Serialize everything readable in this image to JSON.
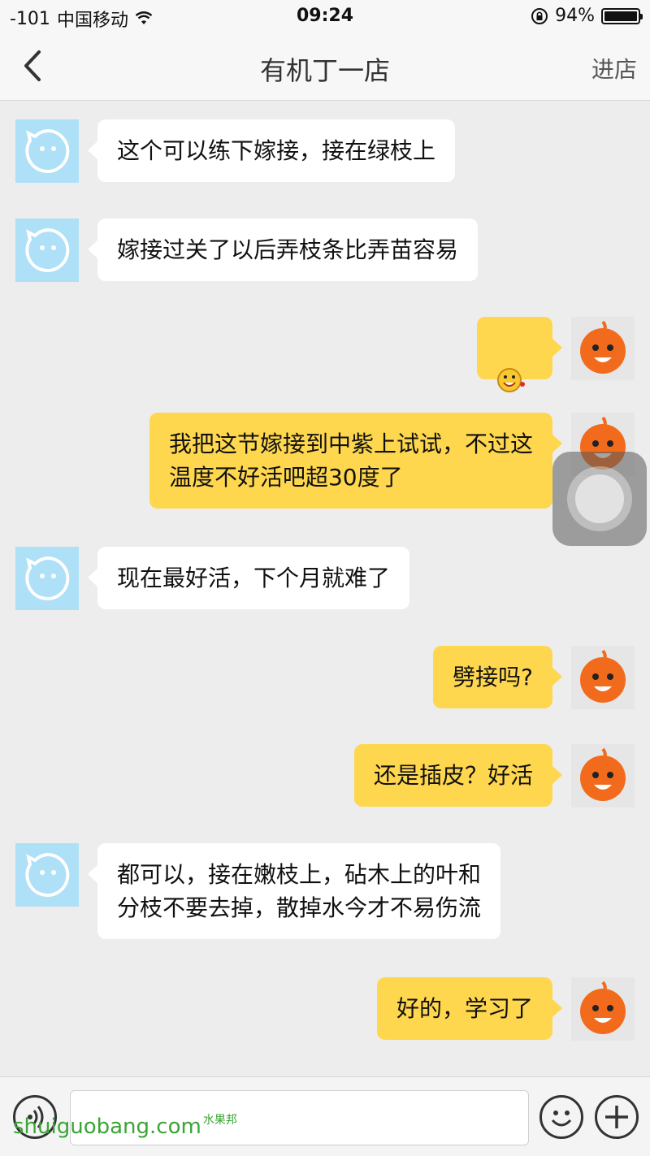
{
  "status_bar": {
    "signal": "-101",
    "carrier": "中国移动",
    "time": "09:24",
    "battery": "94%"
  },
  "header": {
    "title": "有机丁一店",
    "right_action": "进店"
  },
  "messages": [
    {
      "side": "them",
      "text": "这个可以练下嫁接，接在绿枝上"
    },
    {
      "side": "them",
      "text": "嫁接过关了以后弄枝条比弄苗容易"
    },
    {
      "side": "me",
      "type": "emoji",
      "emoji": "grinning-face-sticker"
    },
    {
      "side": "me",
      "text": "我把这节嫁接到中紫上试试，不过这\n温度不好活吧超30度了"
    },
    {
      "side": "them",
      "text": "现在最好活，下个月就难了"
    },
    {
      "side": "me",
      "text": "劈接吗?"
    },
    {
      "side": "me",
      "text": "还是插皮？好活"
    },
    {
      "side": "them",
      "text": "都可以，接在嫩枝上，砧木上的叶和\n分枝不要去掉，散掉水今才不易伤流"
    },
    {
      "side": "me",
      "text": "好的，学习了"
    }
  ],
  "input": {
    "placeholder": ""
  },
  "watermark": {
    "text": "shuiguobang.com",
    "small": "水果邦"
  },
  "colors": {
    "my_bubble": "#fed74e",
    "their_bubble": "#ffffff",
    "their_avatar": "#aee0f7",
    "accent_orange": "#f26b1d",
    "background": "#ededed"
  }
}
